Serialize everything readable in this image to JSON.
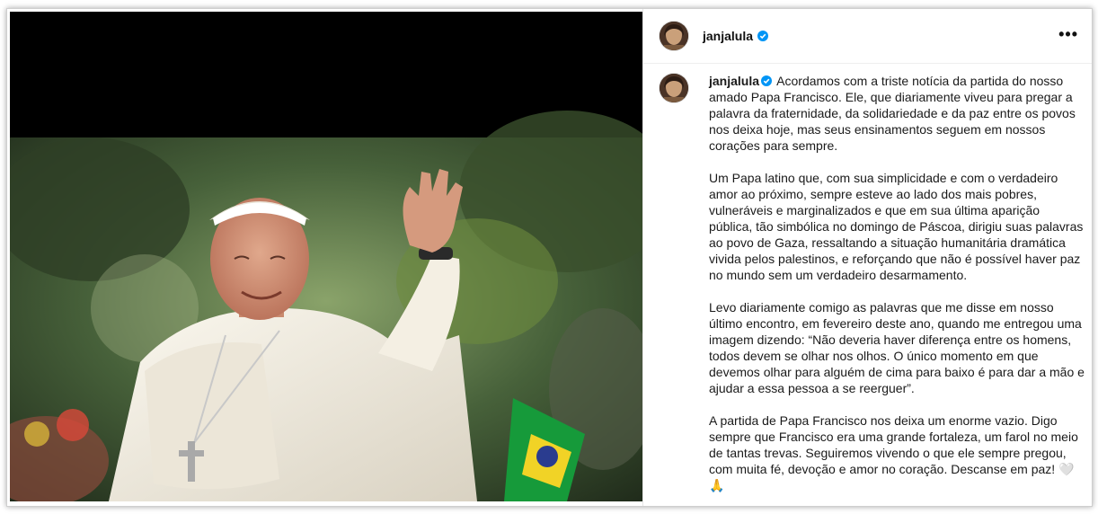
{
  "header": {
    "username": "janjalula",
    "more_label": "•••"
  },
  "caption": {
    "username": "janjalula",
    "paragraphs": [
      "Acordamos com a triste notícia da partida do nosso amado Papa Francisco. Ele, que diariamente viveu para pregar a palavra da fraternidade, da solidariedade e da paz entre os povos nos deixa hoje, mas seus ensinamentos seguem em nossos corações para sempre.",
      "Um Papa latino que, com sua simplicidade e com o verdadeiro amor ao próximo, sempre esteve ao lado dos mais pobres, vulneráveis e marginalizados e que em sua última aparição pública, tão simbólica no domingo de Páscoa, dirigiu suas palavras ao povo de Gaza, ressaltando a situação humanitária dramática vivida pelos palestinos, e reforçando que não é possível haver paz no mundo sem um verdadeiro desarmamento.",
      "Levo diariamente comigo as palavras que me disse em nosso último encontro, em fevereiro deste ano, quando me entregou uma imagem dizendo: “Não deveria haver diferença entre os homens, todos devem se olhar nos olhos. O único momento em que devemos olhar para alguém de cima para baixo é para dar a mão e ajudar a essa pessoa a se reerguer”.",
      "A partida de Papa Francisco nos deixa um enorme vazio. Digo sempre que Francisco era uma grande fortaleza, um farol no meio de tantas trevas. Seguiremos vivendo o que ele sempre pregou, com muita fé, devoção e amor no coração. Descanse em paz! 🤍🙏"
    ]
  },
  "colors": {
    "verified_blue": "#0095f6",
    "text": "#1a1a1a"
  },
  "icons": {
    "verified": "verified-badge-icon",
    "more": "more-options-icon"
  }
}
